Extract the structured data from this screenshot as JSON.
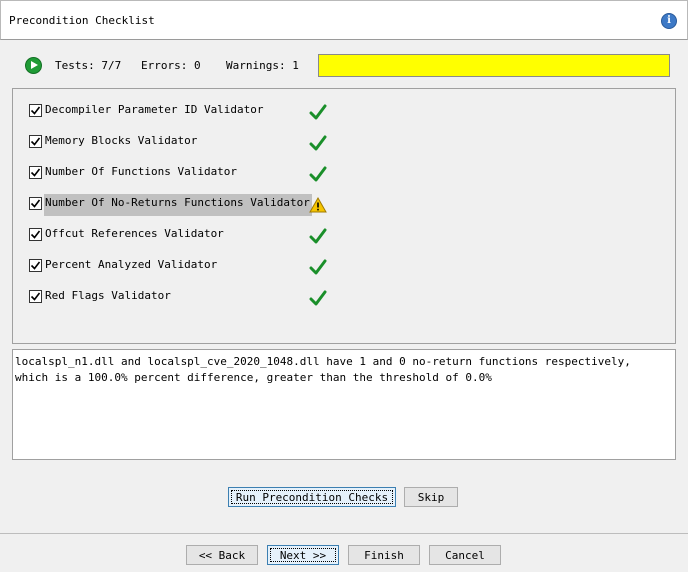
{
  "header": {
    "title": "Precondition Checklist"
  },
  "status": {
    "tests": "Tests: 7/7",
    "errors": "Errors: 0",
    "warnings": "Warnings: 1",
    "progress_percent": 100,
    "progress_color": "#ffff00"
  },
  "checklist": [
    {
      "label": "Decompiler Parameter ID Validator",
      "checked": true,
      "result": "pass"
    },
    {
      "label": "Memory Blocks Validator",
      "checked": true,
      "result": "pass"
    },
    {
      "label": "Number Of Functions Validator",
      "checked": true,
      "result": "pass"
    },
    {
      "label": "Number Of No-Returns Functions Validator",
      "checked": true,
      "result": "warning"
    },
    {
      "label": "Offcut References Validator",
      "checked": true,
      "result": "pass"
    },
    {
      "label": "Percent Analyzed Validator",
      "checked": true,
      "result": "pass"
    },
    {
      "label": "Red Flags Validator",
      "checked": true,
      "result": "pass"
    }
  ],
  "details": {
    "line1": "localspl_n1.dll and localspl_cve_2020_1048.dll have 1 and 0 no-return functions respectively,",
    "line2": "which is a 100.0% percent difference, greater than the threshold of 0.0%"
  },
  "buttons": {
    "run": "Run Precondition Checks",
    "skip": "Skip",
    "back": "<< Back",
    "next": "Next >>",
    "finish": "Finish",
    "cancel": "Cancel"
  }
}
